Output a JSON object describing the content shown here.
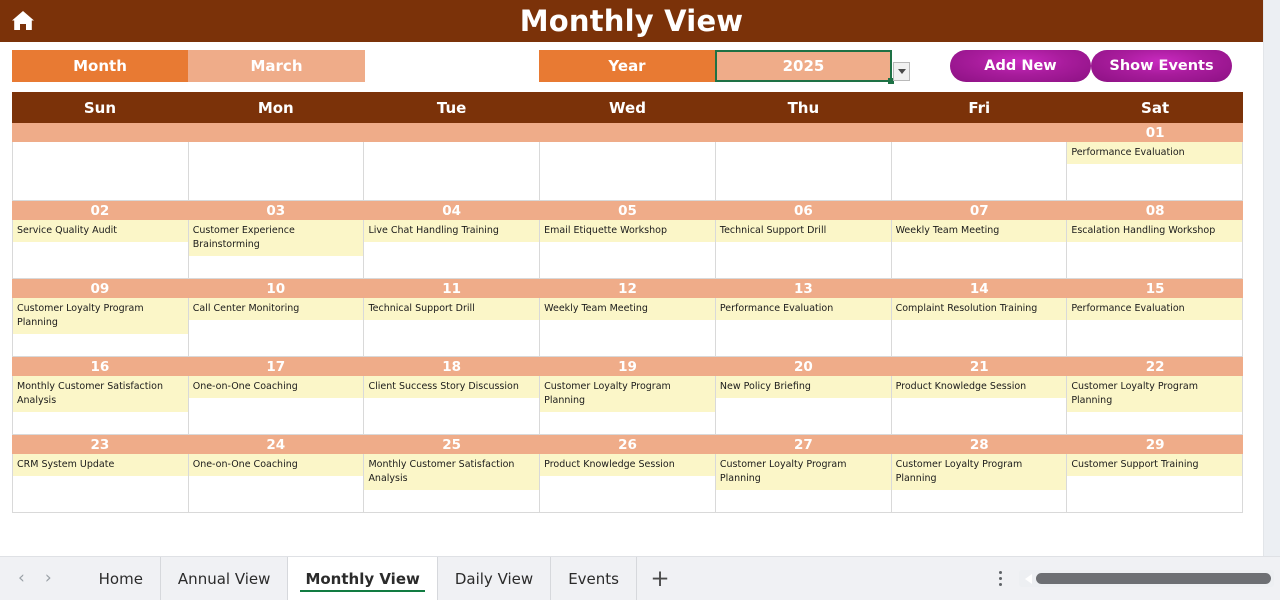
{
  "header": {
    "home_icon": "home-icon",
    "title": "Monthly View"
  },
  "controls": {
    "month_label": "Month",
    "month_value": "March",
    "year_label": "Year",
    "year_value": "2025",
    "dropdown_icon": "chevron-down-icon",
    "add_new_label": "Add New",
    "show_events_label": "Show Events"
  },
  "calendar": {
    "day_headers": [
      "Sun",
      "Mon",
      "Tue",
      "Wed",
      "Thu",
      "Fri",
      "Sat"
    ],
    "weeks": [
      {
        "dates": [
          "",
          "",
          "",
          "",
          "",
          "",
          "01"
        ],
        "events": [
          "",
          "",
          "",
          "",
          "",
          "",
          "Performance Evaluation"
        ]
      },
      {
        "dates": [
          "02",
          "03",
          "04",
          "05",
          "06",
          "07",
          "08"
        ],
        "events": [
          "Service Quality Audit",
          "Customer Experience Brainstorming",
          "Live Chat Handling Training",
          "Email Etiquette Workshop",
          "Technical Support Drill",
          "Weekly Team Meeting",
          "Escalation Handling Workshop"
        ]
      },
      {
        "dates": [
          "09",
          "10",
          "11",
          "12",
          "13",
          "14",
          "15"
        ],
        "events": [
          "Customer Loyalty Program Planning",
          "Call Center Monitoring",
          "Technical Support Drill",
          "Weekly Team Meeting",
          "Performance Evaluation",
          "Complaint Resolution Training",
          "Performance Evaluation"
        ]
      },
      {
        "dates": [
          "16",
          "17",
          "18",
          "19",
          "20",
          "21",
          "22"
        ],
        "events": [
          "Monthly Customer Satisfaction Analysis",
          "One-on-One Coaching",
          "Client Success Story Discussion",
          "Customer Loyalty Program Planning",
          "New Policy Briefing",
          "Product Knowledge Session",
          "Customer Loyalty Program Planning"
        ]
      },
      {
        "dates": [
          "23",
          "24",
          "25",
          "26",
          "27",
          "28",
          "29"
        ],
        "events": [
          "CRM System Update",
          "One-on-One Coaching",
          "Monthly Customer Satisfaction Analysis",
          "Product Knowledge Session",
          "Customer Loyalty Program Planning",
          "Customer Loyalty Program Planning",
          "Customer Support Training"
        ]
      }
    ]
  },
  "sheetbar": {
    "prev_icon": "chevron-left-icon",
    "next_icon": "chevron-right-icon",
    "tabs": [
      {
        "label": "Home",
        "active": false
      },
      {
        "label": "Annual View",
        "active": false
      },
      {
        "label": "Monthly View",
        "active": true
      },
      {
        "label": "Daily View",
        "active": false
      },
      {
        "label": "Events",
        "active": false
      }
    ],
    "add_sheet_label": "+",
    "kebab_icon": "more-options-icon",
    "scroll_left_icon": "scroll-left-arrow-icon"
  },
  "colors": {
    "header_brown": "#7b3209",
    "orange": "#e87a33",
    "light_orange": "#efac89",
    "event_yellow": "#fbf6c8",
    "purple": "#a81c9c",
    "selection_green": "#1e7145"
  }
}
